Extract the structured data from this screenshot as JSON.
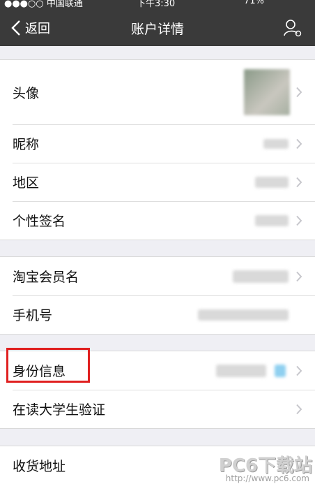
{
  "status_bar": {
    "carrier": "●●●○○ 中国联通 ",
    "time": "下午3:30",
    "battery": "71%"
  },
  "nav": {
    "back_label": "返回",
    "title": "账户详情"
  },
  "group1": [
    {
      "label": "头像"
    },
    {
      "label": "昵称"
    },
    {
      "label": "地区"
    },
    {
      "label": "个性签名"
    }
  ],
  "group2": [
    {
      "label": "淘宝会员名"
    },
    {
      "label": "手机号"
    }
  ],
  "group3": [
    {
      "label": "身份信息"
    },
    {
      "label": "在读大学生验证"
    }
  ],
  "group4": [
    {
      "label": "收货地址"
    }
  ],
  "watermark": {
    "brand": "PC6下载站",
    "url": "http://www.pc6.com"
  },
  "colors": {
    "navbar": "#3a3a3a",
    "background": "#efeff4",
    "highlight": "#e02020"
  }
}
